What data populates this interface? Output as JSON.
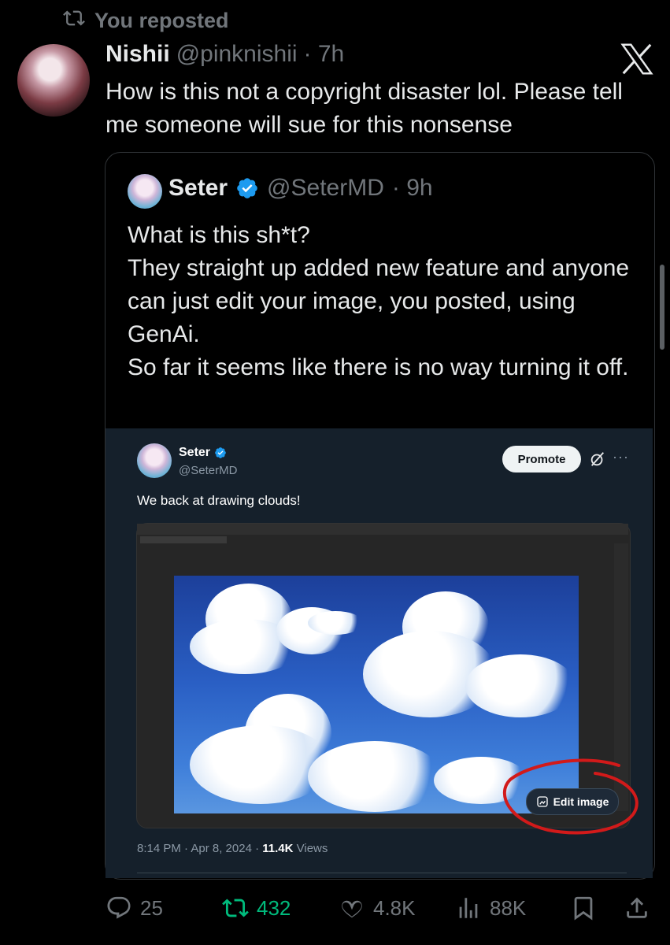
{
  "repost": {
    "label": "You reposted"
  },
  "post": {
    "author_name": "Nishii",
    "author_handle": "@pinknishii",
    "time": "· 7h",
    "text": "How is this not a copyright disaster lol. Please tell me someone will sue for this nonsense"
  },
  "quote": {
    "author_name": "Seter",
    "author_handle": "@SeterMD",
    "time": "· 9h",
    "lines": [
      "What is this sh*t?",
      "They straight up added new feature and anyone can just edit your image, you posted, using GenAi.",
      "So far it seems like there is no way turning it off."
    ]
  },
  "embedded": {
    "author_name": "Seter",
    "author_handle": "@SeterMD",
    "promote_label": "Promote",
    "more": "···",
    "text": "We back at drawing clouds!",
    "edit_image_label": "Edit image",
    "meta_time": "8:14 PM · Apr 8, 2024 · ",
    "meta_views_count": "11.4K",
    "meta_views_label": " Views"
  },
  "actions": {
    "replies": "25",
    "reposts": "432",
    "likes": "4.8K",
    "views": "88K"
  },
  "colors": {
    "background": "#000000",
    "repost_green": "#00ba7c",
    "verified_blue": "#1d9bf0",
    "annotation_red": "#d21a1a"
  }
}
